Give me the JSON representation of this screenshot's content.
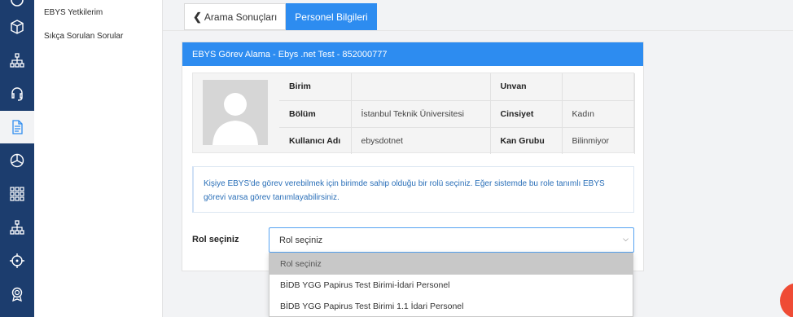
{
  "sidebar": {
    "rail_icons": [
      "box-icon",
      "sitemap-icon",
      "headset-icon",
      "document-icon",
      "pie-chart-icon",
      "grid-icon",
      "org-chart-icon",
      "crosshair-icon",
      "award-icon"
    ],
    "items": [
      {
        "label": "EBYS Yetkilerim"
      },
      {
        "label": "Sıkça Sorulan Sorular"
      }
    ]
  },
  "tabs": [
    {
      "label": "Arama Sonuçları"
    },
    {
      "label": "Personel Bilgileri"
    }
  ],
  "panel": {
    "title": "EBYS Görev Alama - Ebys .net Test - 852000777",
    "info": {
      "rows": [
        {
          "label1": "Birim",
          "value1": "",
          "label2": "Unvan",
          "value2": ""
        },
        {
          "label1": "Bölüm",
          "value1": "İstanbul Teknik Üniversitesi",
          "label2": "Cinsiyet",
          "value2": "Kadın"
        },
        {
          "label1": "Kullanıcı Adı",
          "value1": "ebysdotnet",
          "label2": "Kan Grubu",
          "value2": "Bilinmiyor"
        }
      ]
    },
    "notice": "Kişiye EBYS'de görev verebilmek için birimde sahip olduğu bir rolü seçiniz. Eğer sistemde bu role tanımlı EBYS görevi varsa görev tanımlayabilirsiniz.",
    "role": {
      "label": "Rol seçiniz",
      "selected": "Rol seçiniz",
      "options": [
        "Rol seçiniz",
        "BİDB YGG Papirus Test Birimi-İdari Personel",
        "BİDB YGG Papirus Test Birimi 1.1 İdari Personel"
      ]
    }
  },
  "colors": {
    "rail": "#1c3d6e",
    "accent": "#2d8cf0",
    "notice_text": "#2a6fb8",
    "fab": "#ef4b35"
  }
}
